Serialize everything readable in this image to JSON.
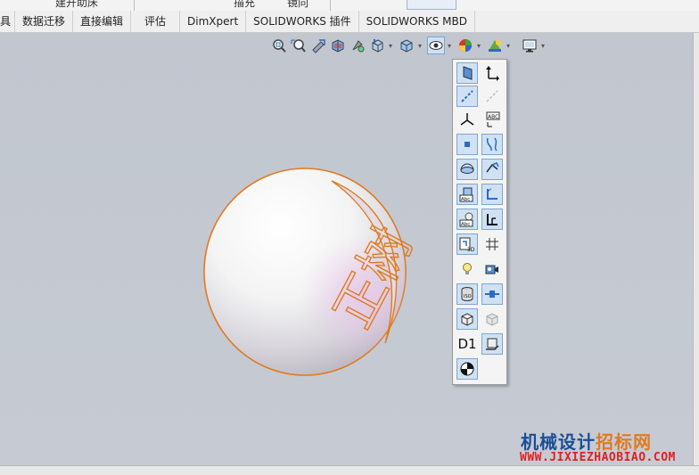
{
  "ribbon_top": {
    "fragment_1": "建开助床",
    "fragment_2": "描充",
    "fragment_3": "镜向"
  },
  "tabs": [
    {
      "id": "tools",
      "label": "具"
    },
    {
      "id": "data-migration",
      "label": "数据迁移"
    },
    {
      "id": "direct-edit",
      "label": "直接编辑"
    },
    {
      "id": "evaluate",
      "label": "评估"
    },
    {
      "id": "dimxpert",
      "label": "DimXpert"
    },
    {
      "id": "sw-addins",
      "label": "SOLIDWORKS 插件"
    },
    {
      "id": "sw-mbd",
      "label": "SOLIDWORKS MBD"
    }
  ],
  "heads_up_toolbar": [
    "zoom-to-fit-icon",
    "zoom-to-area-icon",
    "previous-view-icon",
    "section-view-icon",
    "dynamic-annotation-icon",
    "view-orientation-icon",
    "display-style-icon",
    "hide-show-items-icon",
    "edit-appearance-icon",
    "apply-scene-icon",
    "view-setting-icon"
  ],
  "hide_show_flyout": {
    "d1_label": "D1",
    "items": [
      "view-planes-icon",
      "view-axes-icon",
      "view-temporary-axes-icon",
      "view-origins-icon",
      "view-coordinate-systems-icon",
      "view-annotation-views-icon",
      "view-points-icon",
      "view-curves-icon",
      "view-sketches-icon",
      "view-3d-sketch-planes-icon",
      "view-all-annotations-icon",
      "view-sketch-relations-icon",
      "view-annotation-text-icon",
      "view-weld-bead-icon",
      "view-3d-sketch-icon",
      "view-grid-icon",
      "view-lights-icon",
      "view-cameras-icon",
      "view-decals-icon",
      "view-routing-points-icon",
      "view-parts-icon",
      "view-dimension-names-icon",
      "view-center-of-mass-icon"
    ]
  },
  "model": {
    "engraved_text": "正树"
  },
  "watermark": {
    "brand_a": "机械设计",
    "brand_b": "招标网",
    "url": "WWW.JIXIEZHAOBIAO.COM"
  },
  "colors": {
    "viewport_bg": "#c3c8d0",
    "selection_edge": "#e07a20",
    "active_highlight": "#cfe1f3",
    "watermark_blue": "#1a4f95",
    "watermark_red": "#e02020"
  }
}
